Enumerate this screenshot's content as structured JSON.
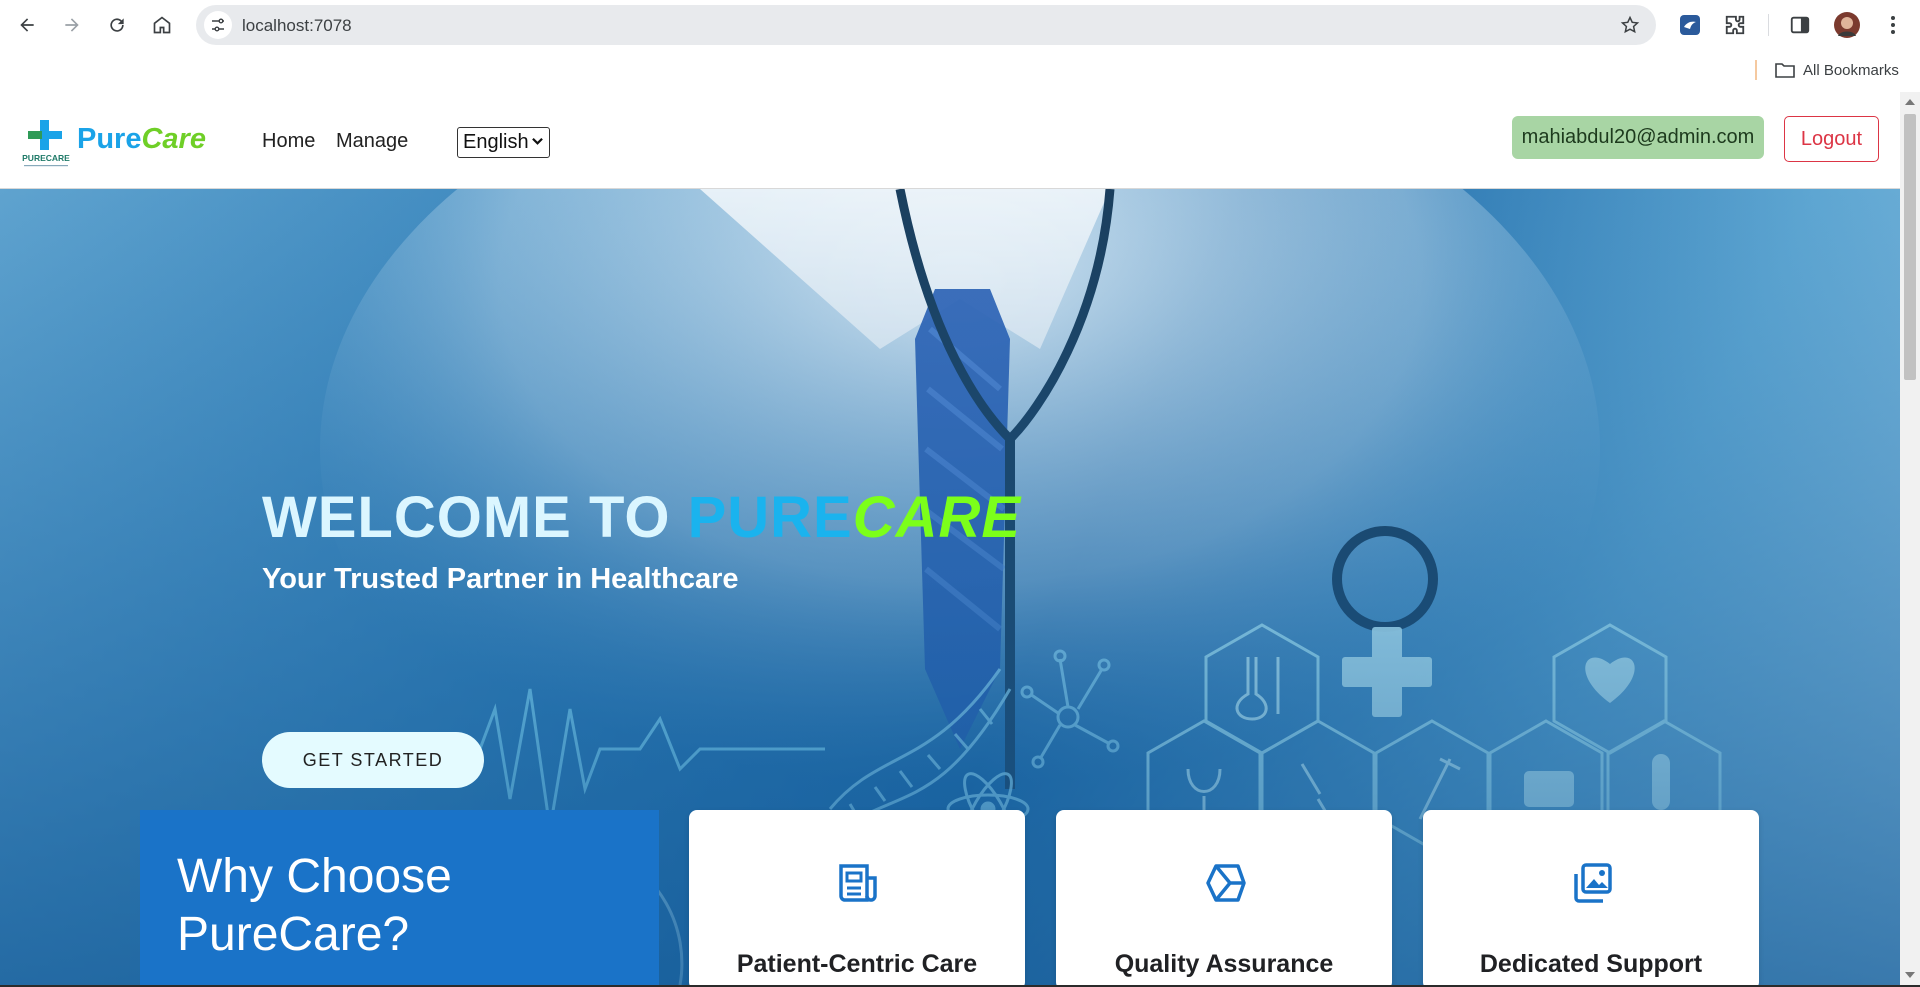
{
  "browser": {
    "url": "localhost:7078",
    "bookmarks_label": "All Bookmarks"
  },
  "site": {
    "logo": {
      "word_pure": "Pure",
      "word_care": "Care",
      "badge_text": "PURECARE"
    },
    "nav": [
      {
        "label": "Home"
      },
      {
        "label": "Manage"
      }
    ],
    "language": {
      "selected": "English"
    },
    "user_email": "mahiabdul20@admin.com",
    "logout_label": "Logout"
  },
  "hero": {
    "title_prefix": "WELCOME TO ",
    "title_pure": "PURE",
    "title_care": "CARE",
    "subtitle": "Your Trusted Partner in Healthcare",
    "cta_label": "GET STARTED"
  },
  "features": {
    "heading": "Why Choose PureCare?",
    "cards": [
      {
        "label": "Patient-Centric Care",
        "icon": "document-icon"
      },
      {
        "label": "Quality Assurance",
        "icon": "cube-icon"
      },
      {
        "label": "Dedicated Support",
        "icon": "image-gallery-icon"
      }
    ]
  },
  "colors": {
    "brand_blue": "#1aa3e8",
    "brand_green": "#6fcf27",
    "hero_care_green": "#7cff1a",
    "why_box_blue": "#1a73c8",
    "logout_red": "#dc3545",
    "email_badge_green": "#a8d5a4"
  }
}
